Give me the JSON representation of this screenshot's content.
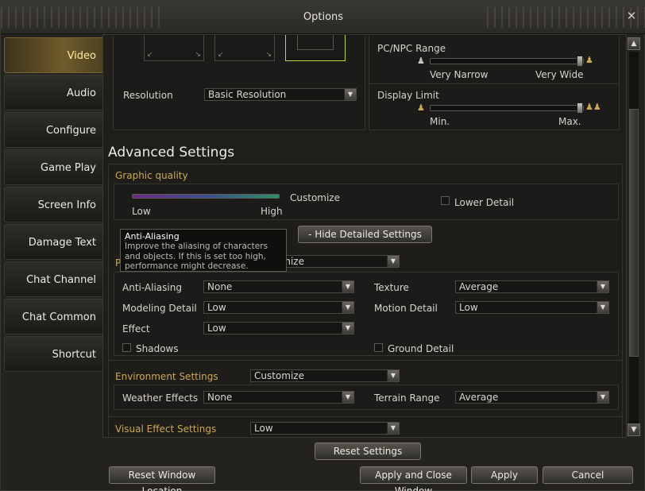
{
  "window": {
    "title": "Options",
    "close_icon": "close-icon"
  },
  "sidebar": {
    "items": [
      {
        "label": "Video",
        "active": true
      },
      {
        "label": "Audio"
      },
      {
        "label": "Configure"
      },
      {
        "label": "Game Play"
      },
      {
        "label": "Screen Info"
      },
      {
        "label": "Damage Text"
      },
      {
        "label": "Chat Channel"
      },
      {
        "label": "Chat Common"
      },
      {
        "label": "Shortcut"
      }
    ]
  },
  "video": {
    "resolution_label": "Resolution",
    "resolution_value": "Basic Resolution",
    "pcnpc_range": {
      "label": "PC/NPC Range",
      "min": "Very Narrow",
      "max": "Very Wide",
      "level": 1.0
    },
    "display_limit": {
      "label": "Display Limit",
      "min": "Min.",
      "max": "Max.",
      "level": 1.0
    }
  },
  "advanced": {
    "title": "Advanced Settings",
    "graphic_quality": {
      "label": "Graphic quality",
      "low": "Low",
      "high": "High",
      "current": "Customize",
      "lower_detail_label": "Lower Detail",
      "lower_detail_checked": false
    },
    "hide_details_button": "-   Hide Detailed Settings",
    "preset_select": "Customize",
    "rows": {
      "anti_aliasing": {
        "label": "Anti-Aliasing",
        "value": "None"
      },
      "texture": {
        "label": "Texture",
        "value": "Average"
      },
      "modeling_detail": {
        "label": "Modeling Detail",
        "value": "Low"
      },
      "motion_detail": {
        "label": "Motion Detail",
        "value": "Low"
      },
      "effect": {
        "label": "Effect",
        "value": "Low"
      },
      "shadows": {
        "label": "Shadows",
        "checked": false
      },
      "ground_detail": {
        "label": "Ground Detail",
        "checked": false
      }
    },
    "environment": {
      "label": "Environment Settings",
      "value": "Customize",
      "weather_label": "Weather Effects",
      "weather_value": "None",
      "terrain_label": "Terrain Range",
      "terrain_value": "Average"
    },
    "visual_effect": {
      "label": "Visual Effect Settings",
      "value": "Low"
    }
  },
  "tooltip": {
    "title": "Anti-Aliasing",
    "line1": "Improve the aliasing of characters",
    "line2": "and objects. If this is set too high,",
    "line3": "performance might decrease."
  },
  "buttons": {
    "reset_settings": "Reset Settings",
    "reset_window": "Reset Window Location",
    "apply_close": "Apply and Close Window",
    "apply": "Apply",
    "cancel": "Cancel"
  },
  "colors": {
    "accent_gold": "#c9a85a",
    "selected_thumb": "#b8d23a"
  }
}
